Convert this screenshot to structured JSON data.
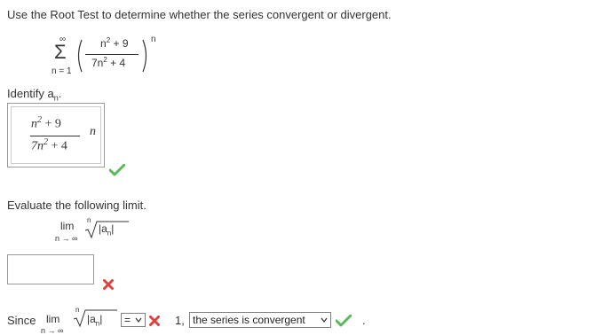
{
  "question": {
    "prompt": "Use the Root Test to determine whether the series convergent or divergent.",
    "series": {
      "sigma": "Σ",
      "upper_limit": "∞",
      "lower_limit": "n = 1",
      "numerator": "n",
      "numerator_exp": "2",
      "numerator_rest": " + 9",
      "denominator": "7n",
      "denominator_exp": "2",
      "denominator_rest": " + 4",
      "outer_exp": "n"
    }
  },
  "identify": {
    "label": "Identify a",
    "label_sub": "n",
    "label_end": ".",
    "answer": {
      "num_n": "n",
      "num_exp": "2",
      "num_rest": " + 9",
      "den_n": "7n",
      "den_exp": "2",
      "den_rest": " + 4",
      "trailing": "n"
    },
    "status": "correct"
  },
  "evaluate": {
    "label": "Evaluate the following limit.",
    "lim": "lim",
    "lim_sub": "n → ∞",
    "root_index": "n",
    "abs_expr": "|a",
    "abs_sub": "n",
    "abs_end": "|",
    "input_value": "",
    "status": "incorrect"
  },
  "since": {
    "label": "Since",
    "lim": "lim",
    "lim_sub": "n → ∞",
    "root_index": "n",
    "abs_expr": "|a",
    "abs_sub": "n",
    "abs_end": "|",
    "relation_select": "=",
    "relation_status": "incorrect",
    "value": "1,",
    "conclusion_select": "the series is convergent",
    "conclusion_status": "correct",
    "end": "."
  },
  "colors": {
    "text": "#333333",
    "correct": "#5cb85c",
    "incorrect": "#e0413e",
    "border": "#9a9a9a"
  }
}
